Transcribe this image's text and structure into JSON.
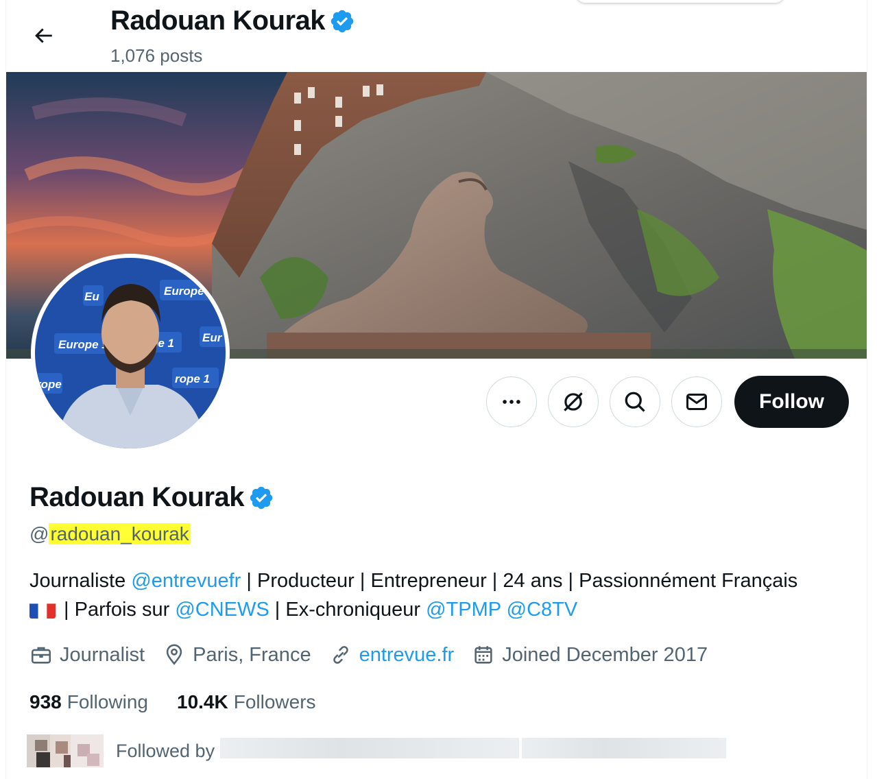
{
  "header": {
    "name": "Radouan Kourak",
    "posts": "1,076 posts"
  },
  "profile": {
    "display_name": "Radouan Kourak",
    "handle_prefix": "@",
    "handle": "radouan_kourak",
    "bio": {
      "p1": "Journaliste ",
      "m1": "@entrevuefr",
      "p2": " | Producteur | Entrepreneur | 24 ans | Passionnément Français",
      "p3": " | Parfois sur ",
      "m2": "@CNEWS",
      "p4": " |  Ex-chroniqueur ",
      "m3": "@TPMP",
      "p5": " ",
      "m4": "@C8TV"
    },
    "meta": {
      "category": "Journalist",
      "location": "Paris, France",
      "website": "entrevue.fr",
      "joined": "Joined December 2017"
    },
    "stats": {
      "following_count": "938",
      "following_label": "Following",
      "followers_count": "10.4K",
      "followers_label": "Followers"
    },
    "followed_by_label": "Followed by",
    "avatar_backdrop_text": [
      "Europe",
      "Europe 1",
      "rope 1",
      "Eur",
      "rope",
      "Eu"
    ]
  },
  "actions": {
    "follow_label": "Follow"
  },
  "colors": {
    "accent": "#1d9bf0",
    "text": "#0f1419",
    "secondary_text": "#536471",
    "follow_bg": "#0f1419",
    "highlight": "#ffff33"
  },
  "icons": [
    "back-arrow-icon",
    "verified-badge-icon",
    "more-icon",
    "subscribe-icon",
    "search-icon",
    "mail-icon",
    "briefcase-icon",
    "location-icon",
    "link-icon",
    "calendar-icon"
  ]
}
